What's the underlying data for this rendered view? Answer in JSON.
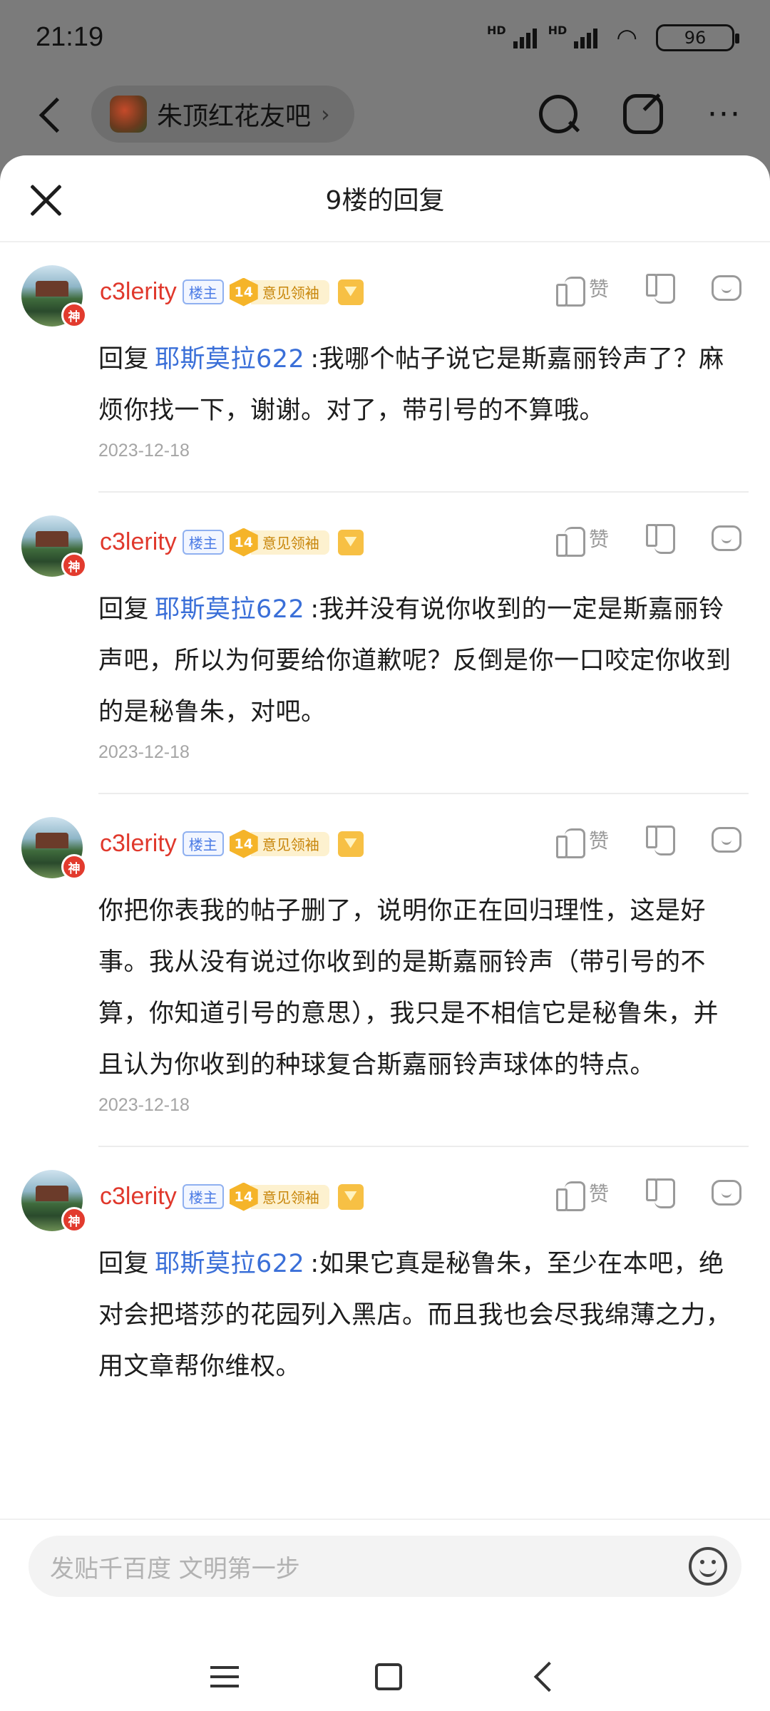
{
  "status_bar": {
    "time": "21:19",
    "network_1": "HD",
    "network_2": "HD",
    "battery": "96"
  },
  "header": {
    "forum_name": "朱顶红花友吧",
    "chevron": "›"
  },
  "sheet": {
    "title": "9楼的回复"
  },
  "badges": {
    "god": "神",
    "owner": "楼主",
    "level": "14",
    "level_title": "意见领袖",
    "like_label": "赞"
  },
  "replies": [
    {
      "username": "c3lerity",
      "prefix": "回复",
      "mention": "耶斯莫拉622",
      "text": ":我哪个帖子说它是斯嘉丽铃声了？麻烦你找一下，谢谢。对了，带引号的不算哦。",
      "date": "2023-12-18"
    },
    {
      "username": "c3lerity",
      "prefix": "回复",
      "mention": "耶斯莫拉622",
      "text": ":我并没有说你收到的一定是斯嘉丽铃声吧，所以为何要给你道歉呢？反倒是你一口咬定你收到的是秘鲁朱，对吧。",
      "date": "2023-12-18"
    },
    {
      "username": "c3lerity",
      "prefix": "",
      "mention": "",
      "text": "你把你表我的帖子删了，说明你正在回归理性，这是好事。我从没有说过你收到的是斯嘉丽铃声（带引号的不算，你知道引号的意思），我只是不相信它是秘鲁朱，并且认为你收到的种球复合斯嘉丽铃声球体的特点。",
      "date": "2023-12-18"
    },
    {
      "username": "c3lerity",
      "prefix": "回复",
      "mention": "耶斯莫拉622",
      "text": ":如果它真是秘鲁朱，至少在本吧，绝对会把塔莎的花园列入黑店。而且我也会尽我绵薄之力，用文章帮你维权。",
      "date": ""
    }
  ],
  "composer": {
    "placeholder": "发贴千百度 文明第一步"
  },
  "icons": [
    "back-icon",
    "search-icon",
    "edit-icon",
    "more-icon",
    "close-icon",
    "thumb-up-icon",
    "thumb-down-icon",
    "comment-icon",
    "emoji-icon",
    "menu-icon",
    "home-icon",
    "nav-back-icon"
  ]
}
